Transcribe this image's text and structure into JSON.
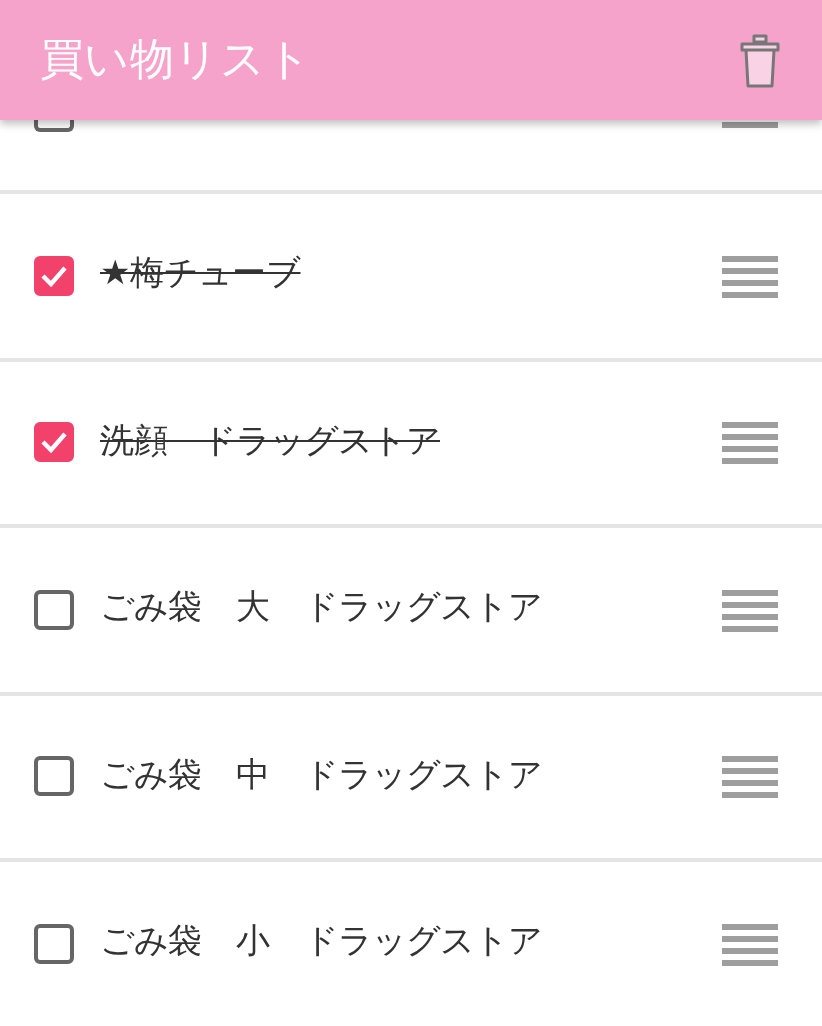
{
  "app_bar": {
    "title": "買い物リスト"
  },
  "items": [
    {
      "kind": "cut",
      "checked": false
    },
    {
      "text": "★梅チューブ",
      "checked": true
    },
    {
      "text": "洗顔　ドラッグストア",
      "checked": true
    },
    {
      "text": "ごみ袋　大　ドラッグストア",
      "checked": false
    },
    {
      "text": "ごみ袋　中　ドラッグストア",
      "checked": false
    },
    {
      "text": "ごみ袋　小　ドラッグストア",
      "checked": false
    }
  ]
}
